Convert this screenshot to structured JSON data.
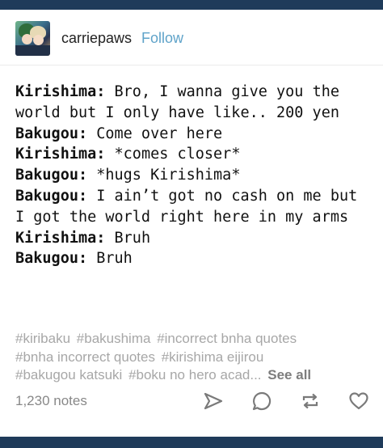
{
  "post": {
    "author": "carriepaws",
    "follow_label": "Follow",
    "lines": [
      {
        "speaker": "Kirishima:",
        "text": " Bro, I wanna give you the world but I only have like.. 200 yen"
      },
      {
        "speaker": "Bakugou:",
        "text": " Come over here"
      },
      {
        "speaker": "Kirishima:",
        "text": " *comes closer*"
      },
      {
        "speaker": "Bakugou:",
        "text": " *hugs Kirishima*"
      },
      {
        "speaker": "Bakugou:",
        "text": " I ain’t got no cash on me but I got the world right here in my arms"
      },
      {
        "speaker": "Kirishima:",
        "text": " Bruh"
      },
      {
        "speaker": "Bakugou:",
        "text": " Bruh"
      }
    ],
    "tags": [
      "#kiribaku",
      "#bakushima",
      "#incorrect bnha quotes",
      "#bnha incorrect quotes",
      "#kirishima eijirou",
      "#bakugou katsuki",
      "#boku no hero acad..."
    ],
    "see_all_label": "See all",
    "notes": "1,230 notes"
  },
  "icons": {
    "share": "share-icon",
    "reply": "reply-icon",
    "reblog": "reblog-icon",
    "like": "heart-icon"
  },
  "colors": {
    "bar": "#1f3b5a",
    "follow": "#5fa3c9",
    "tags": "#a7a7a7",
    "icons": "#7a7a7a"
  }
}
